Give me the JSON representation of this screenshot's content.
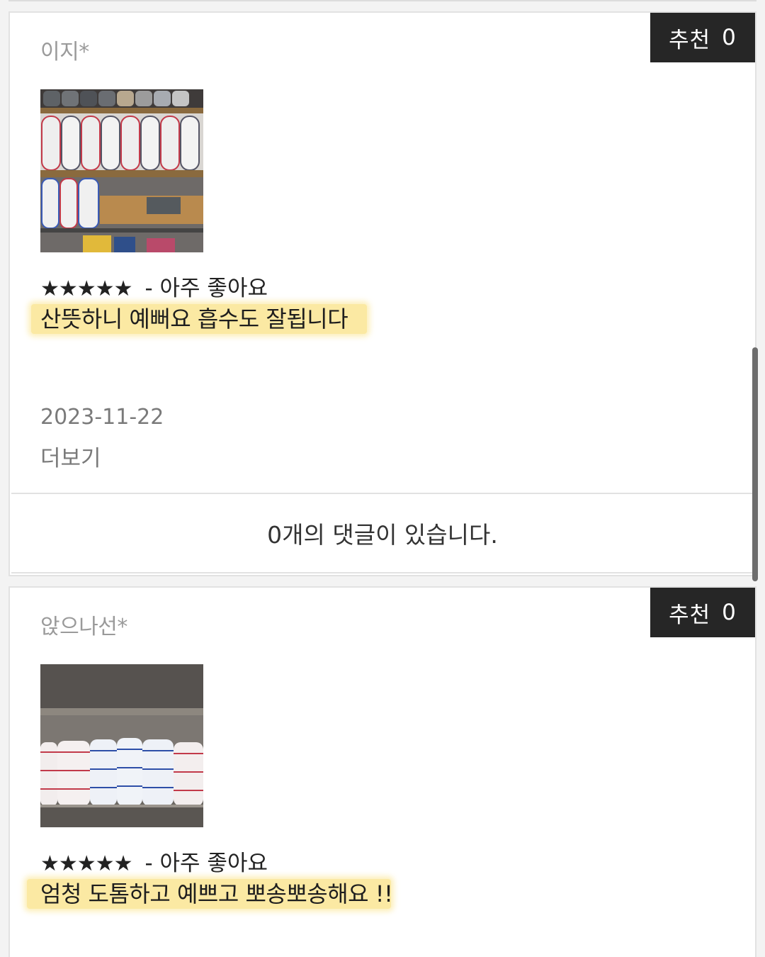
{
  "reviews": [
    {
      "reviewer": "이지*",
      "recommend_label": "추천",
      "recommend_count": "0",
      "photo_icon": "towel-shelf-photo",
      "stars": "★★★★★",
      "rating_text": "- 아주 좋아요",
      "text": "산뜻하니 예뻐요 흡수도 잘됩니다",
      "date": "2023-11-22",
      "more_label": "더보기",
      "comments_label": "0개의 댓글이 있습니다."
    },
    {
      "reviewer": "앉으나선*",
      "recommend_label": "추천",
      "recommend_count": "0",
      "photo_icon": "towel-shelf-photo",
      "stars": "★★★★★",
      "rating_text": "- 아주 좋아요",
      "text": "엄청 도톰하고 예쁘고 뽀송뽀송해요 !!"
    }
  ],
  "colors": {
    "highlight": "#fbe9a3",
    "recommend_bg": "#262626",
    "muted_text": "#9a9a9a"
  }
}
